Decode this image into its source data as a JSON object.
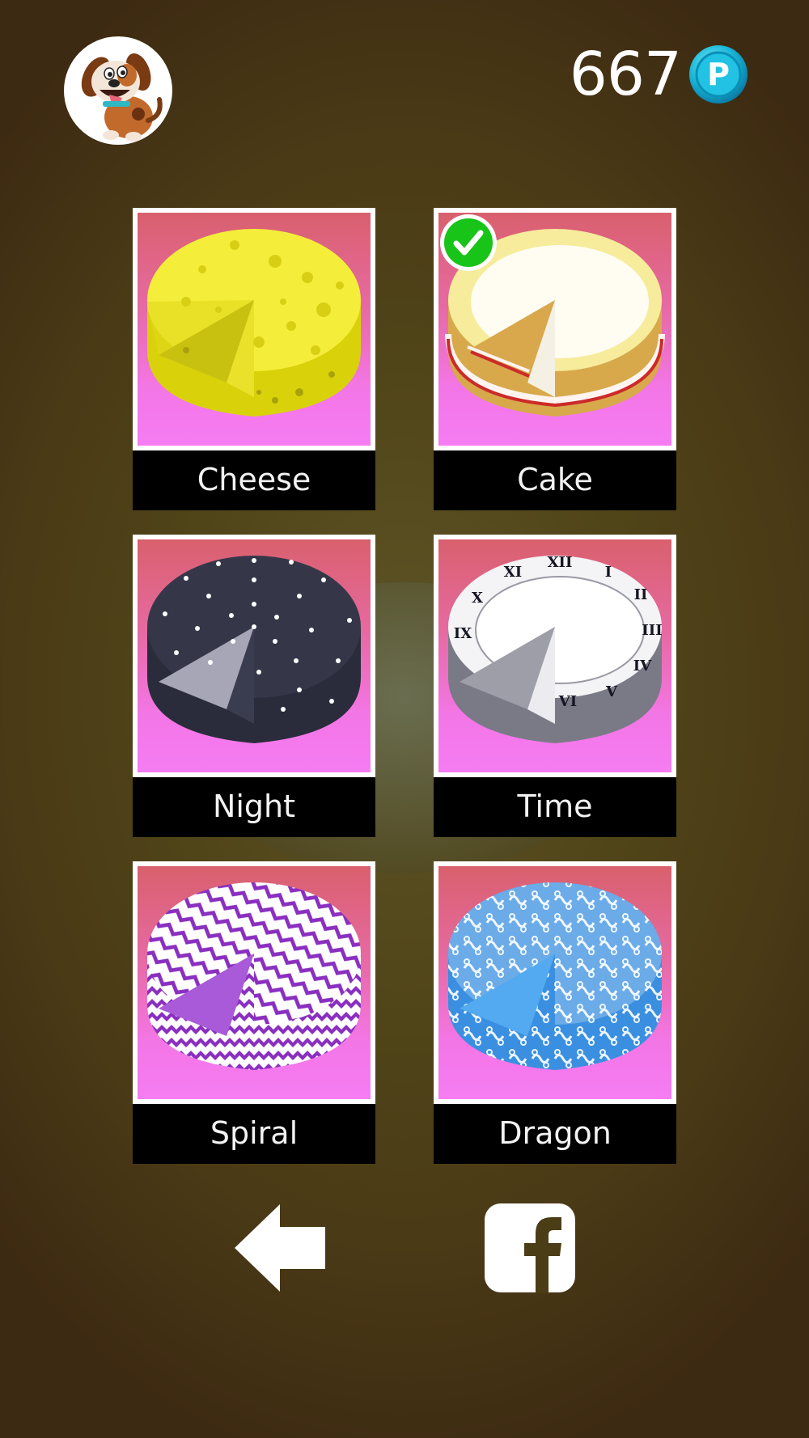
{
  "header": {
    "coins": "667",
    "coin_icon": "p-coin-icon",
    "avatar_icon": "dog-avatar-icon"
  },
  "skins": [
    {
      "label": "Cheese",
      "selected": false
    },
    {
      "label": "Cake",
      "selected": true
    },
    {
      "label": "Night",
      "selected": false
    },
    {
      "label": "Time",
      "selected": false
    },
    {
      "label": "Spiral",
      "selected": false
    },
    {
      "label": "Dragon",
      "selected": false
    }
  ],
  "nav": {
    "back_icon": "back-arrow-icon",
    "share_icon": "facebook-icon"
  },
  "colors": {
    "card_top": "#d9606d",
    "card_bottom": "#f57cf2",
    "label_bg": "#000000",
    "check_green": "#18c418"
  }
}
